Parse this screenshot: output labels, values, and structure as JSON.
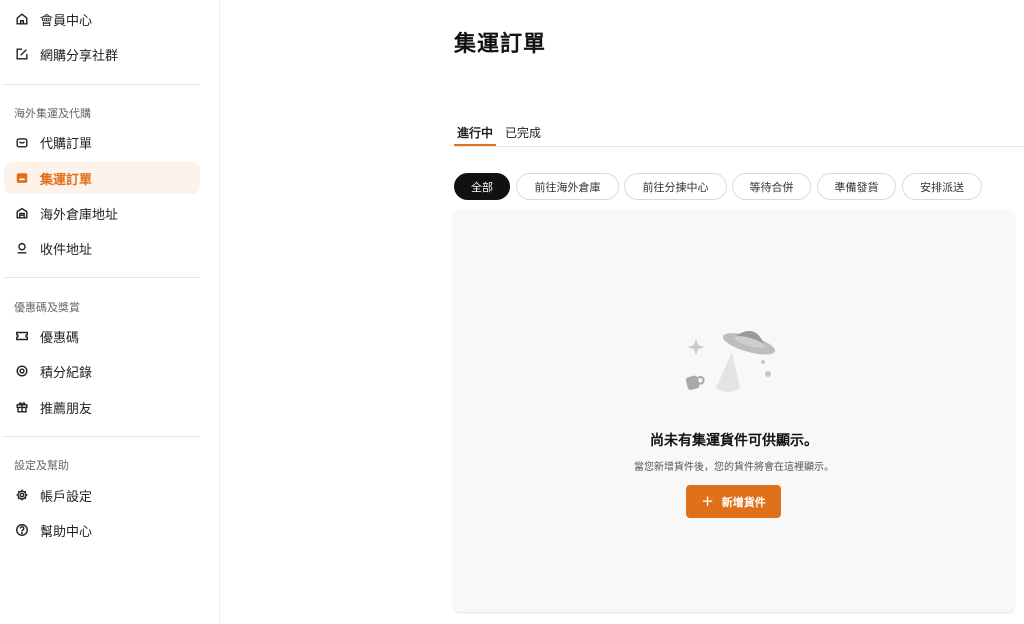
{
  "sidebar": {
    "top_items": [
      {
        "label": "會員中心",
        "icon": "home-icon"
      },
      {
        "label": "網購分享社群",
        "icon": "edit-icon"
      }
    ],
    "sections": [
      {
        "label": "海外集運及代購",
        "items": [
          {
            "label": "代購訂單",
            "icon": "shopping-bag-icon"
          },
          {
            "label": "集運訂單",
            "icon": "package-icon",
            "active": true
          },
          {
            "label": "海外倉庫地址",
            "icon": "warehouse-icon"
          },
          {
            "label": "收件地址",
            "icon": "location-pin-icon"
          }
        ]
      },
      {
        "label": "優惠碼及獎賞",
        "items": [
          {
            "label": "優惠碼",
            "icon": "ticket-icon"
          },
          {
            "label": "積分紀錄",
            "icon": "points-icon"
          },
          {
            "label": "推薦朋友",
            "icon": "gift-icon"
          }
        ]
      },
      {
        "label": "設定及幫助",
        "items": [
          {
            "label": "帳戶設定",
            "icon": "gear-icon"
          },
          {
            "label": "幫助中心",
            "icon": "help-icon"
          }
        ]
      }
    ],
    "accent_color": "#e0701a"
  },
  "main": {
    "title": "集運訂單",
    "tabs": [
      {
        "label": "進行中",
        "active": true
      },
      {
        "label": "已完成"
      }
    ],
    "filters": [
      {
        "label": "全部",
        "active": true
      },
      {
        "label": "前往海外倉庫"
      },
      {
        "label": "前往分揀中心"
      },
      {
        "label": "等待合併"
      },
      {
        "label": "準備發貨"
      },
      {
        "label": "安排派送"
      }
    ],
    "empty_state": {
      "illustration": "ufo-icon",
      "title": "尚未有集運貨件可供顯示。",
      "subtitle": "當您新增貨件後，您的貨件將會在這裡顯示。",
      "button_label": "新增貨件",
      "button_icon": "plus-icon"
    }
  }
}
